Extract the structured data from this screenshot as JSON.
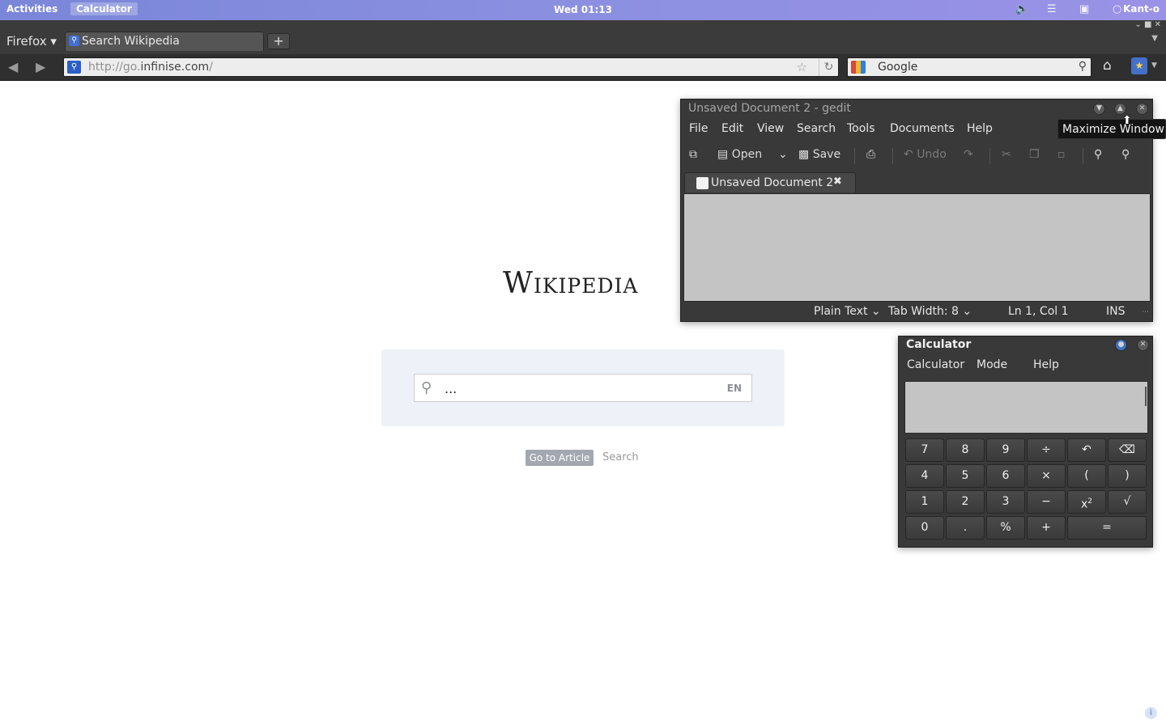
{
  "top_panel": {
    "activities": "Activities",
    "app_name": "Calculator",
    "clock": "Wed 01:13",
    "user": "Kant-o",
    "icons": [
      "volume-icon",
      "wifi-icon",
      "battery-icon",
      "chat-status-icon"
    ]
  },
  "firefox": {
    "menu_label": "Firefox ▾",
    "tab_title": "Search Wikipedia",
    "new_tab": "+",
    "url_prefix": "http://go.",
    "url_host": "infinise.com",
    "url_suffix": "/",
    "search_engine": "Google"
  },
  "wikipedia": {
    "logo": "Wikipedia",
    "search_value": "...",
    "lang": "EN",
    "go_button": "Go to Article",
    "search_link": "Search"
  },
  "gedit": {
    "title": "Unsaved Document 2 - gedit",
    "tooltip": "Maximize Window",
    "menu": [
      "File",
      "Edit",
      "View",
      "Search",
      "Tools",
      "Documents",
      "Help"
    ],
    "toolbar": {
      "open": "Open",
      "save": "Save",
      "undo": "Undo"
    },
    "tab_label": "Unsaved Document 2",
    "status": {
      "language": "Plain Text",
      "tab_width": "Tab Width:  8",
      "position": "Ln 1, Col 1",
      "mode": "INS"
    }
  },
  "calculator": {
    "title": "Calculator",
    "menu": [
      "Calculator",
      "Mode",
      "Help"
    ],
    "keys": {
      "k7": "7",
      "k8": "8",
      "k9": "9",
      "div": "÷",
      "k4": "4",
      "k5": "5",
      "k6": "6",
      "mul": "×",
      "lparen": "(",
      "rparen": ")",
      "k1": "1",
      "k2": "2",
      "k3": "3",
      "sub": "−",
      "sqrt": "√",
      "k0": "0",
      "dot": ".",
      "pct": "%",
      "add": "+",
      "eq": "="
    }
  }
}
